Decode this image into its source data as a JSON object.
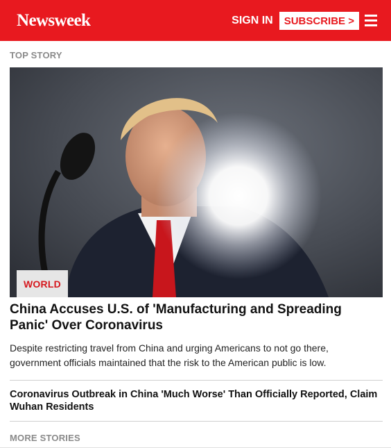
{
  "header": {
    "logo": "Newsweek",
    "sign_in": "SIGN IN",
    "subscribe": "SUBSCRIBE >",
    "menu_icon": "hamburger-menu-icon",
    "brand_color": "#e8191f"
  },
  "top_story": {
    "section_label": "TOP STORY",
    "category": "WORLD",
    "headline": "China Accuses U.S. of 'Manufacturing and Spreading Panic' Over Coronavirus",
    "summary": "Despite restricting travel from China and urging Americans to not go there, government officials maintained that the risk to the American public is low."
  },
  "related": {
    "headline": "Coronavirus Outbreak in China 'Much Worse' Than Officially Reported, Claim Wuhan Residents"
  },
  "more_stories": {
    "section_label": "MORE STORIES"
  }
}
